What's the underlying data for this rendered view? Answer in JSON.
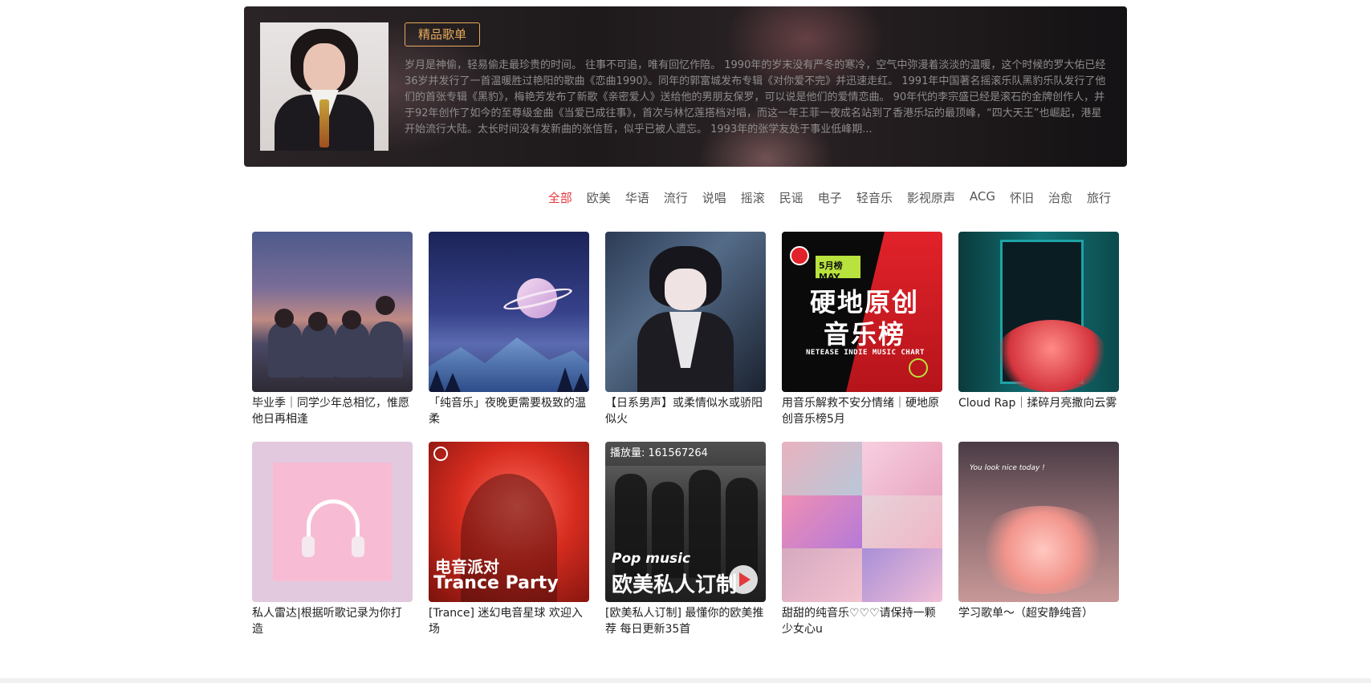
{
  "hero": {
    "badge": "精品歌单",
    "description": "岁月是神偷，轻易偷走最珍贵的时间。 往事不可追，唯有回忆作陪。 1990年的岁末没有严冬的寒冷，空气中弥漫着淡淡的温暖，这个时候的罗大佑已经36岁并发行了一首温暖胜过艳阳的歌曲《恋曲1990》。同年的郭富城发布专辑《对你爱不完》并迅速走红。 1991年中国著名摇滚乐队黑豹乐队发行了他们的首张专辑《黑豹》，梅艳芳发布了新歌《亲密爱人》送给他的男朋友保罗，可以说是他们的爱情恋曲。 90年代的李宗盛已经是滚石的金牌创作人，并于92年创作了如今的至尊级金曲《当爱已成往事》，首次与林忆莲搭档对唱，而这一年王菲一夜成名站到了香港乐坛的最顶峰，“四大天王”也崛起，港星开始流行大陆。太长时间没有发新曲的张信哲，似乎已被人遗忘。 1993年的张学友处于事业低峰期..."
  },
  "tabs": [
    "全部",
    "欧美",
    "华语",
    "流行",
    "说唱",
    "摇滚",
    "民谣",
    "电子",
    "轻音乐",
    "影视原声",
    "ACG",
    "怀旧",
    "治愈",
    "旅行"
  ],
  "active_tab": "全部",
  "playlists": [
    {
      "title": "毕业季｜同学少年总相忆，惟愿他日再相逢"
    },
    {
      "title": "「纯音乐」夜晚更需要极致的温柔"
    },
    {
      "title": "【日系男声】或柔情似水或骄阳似火"
    },
    {
      "title": "用音乐解救不安分情绪｜硬地原创音乐榜5月"
    },
    {
      "title": "Cloud Rap｜揉碎月亮撒向云雾"
    },
    {
      "title": "私人雷达|根据听歌记录为你打造"
    },
    {
      "title": "[Trance] 迷幻电音星球 欢迎入场"
    },
    {
      "title": "[欧美私人订制] 最懂你的欧美推荐 每日更新35首"
    },
    {
      "title": "甜甜的纯音乐♡♡♡请保持一颗少女心u"
    },
    {
      "title": "学习歌单～（超安静纯音）"
    }
  ],
  "cover_text": {
    "indie_badge": "5月榜 MAY.",
    "indie_title": "硬地原创音乐榜",
    "indie_sub": "NETEASE INDIE MUSIC CHART",
    "trance_cn": "电音派对",
    "trance_en": "Trance Party",
    "pop_play_count": "播放量: 161567264",
    "pop_en": "Pop music",
    "pop_cn": "欧美私人订制",
    "study_hand": "You look nice today !"
  },
  "colors": {
    "accent": "#e3393c",
    "badge": "#e7aa5a"
  }
}
